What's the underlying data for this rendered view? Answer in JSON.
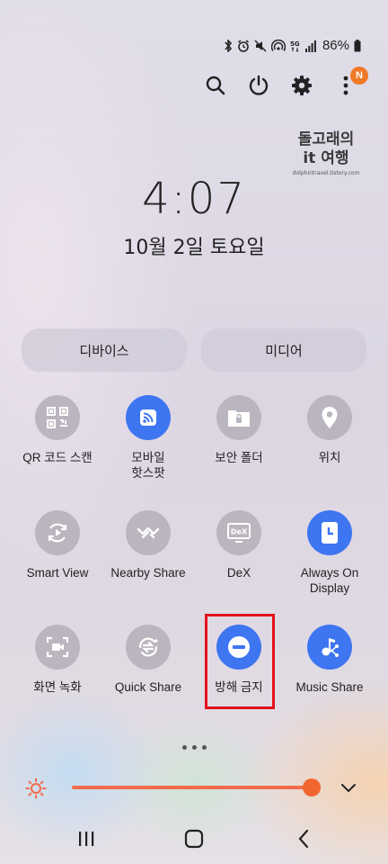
{
  "status_bar": {
    "battery_percent": "86%",
    "icons": [
      "bluetooth-icon",
      "alarm-icon",
      "mute-icon",
      "hotspot-icon",
      "5g-icon",
      "signal-icon",
      "battery-icon"
    ]
  },
  "top_actions": {
    "icons": [
      "search-icon",
      "power-icon",
      "gear-icon",
      "more-icon"
    ],
    "notification_badge": "N"
  },
  "watermark": {
    "line1": "돌고래의",
    "line2": "it 여행",
    "line3": "dolphintravel.tistory.com"
  },
  "clock": {
    "time": "4:07",
    "date": "10월 2일 토요일"
  },
  "pills": {
    "devices": "디바이스",
    "media": "미디어"
  },
  "tiles": [
    {
      "label": "QR 코드 스캔",
      "icon": "qr-icon",
      "active": false
    },
    {
      "label": "모바일\n핫스팟",
      "icon": "hotspot-icon",
      "active": true
    },
    {
      "label": "보안 폴더",
      "icon": "secure-folder-icon",
      "active": false
    },
    {
      "label": "위치",
      "icon": "location-icon",
      "active": false
    },
    {
      "label": "Smart View",
      "icon": "smart-view-icon",
      "active": false
    },
    {
      "label": "Nearby Share",
      "icon": "nearby-share-icon",
      "active": false
    },
    {
      "label": "DeX",
      "icon": "dex-icon",
      "active": false,
      "badge_text": "DeX"
    },
    {
      "label": "Always On\nDisplay",
      "icon": "clock-icon",
      "active": true
    },
    {
      "label": "화면 녹화",
      "icon": "screen-record-icon",
      "active": false
    },
    {
      "label": "Quick Share",
      "icon": "quick-share-icon",
      "active": false
    },
    {
      "label": "방해 금지",
      "icon": "do-not-disturb-icon",
      "active": true
    },
    {
      "label": "Music Share",
      "icon": "music-share-icon",
      "active": true
    }
  ],
  "brightness": {
    "level": 0.99,
    "icons": [
      "sun-icon",
      "chevron-down-icon"
    ]
  },
  "colors": {
    "accent": "#3e75f1",
    "slider": "#f26b4c",
    "highlight": "#e3121c",
    "badge": "#f07a28"
  },
  "nav": {
    "icons": [
      "recents-icon",
      "home-icon",
      "back-icon"
    ]
  }
}
